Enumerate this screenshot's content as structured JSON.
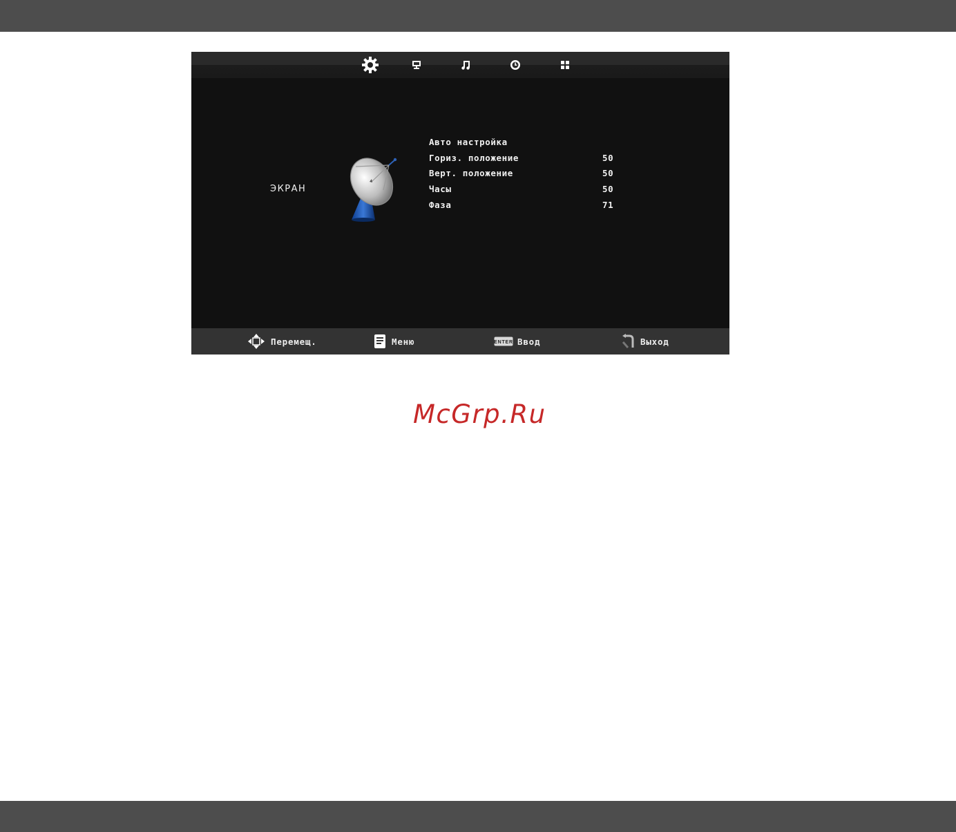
{
  "screen": {
    "section_title": "ЭКРАН",
    "tabs": [
      {
        "icon": "gear-icon",
        "selected": true
      },
      {
        "icon": "monitor-icon",
        "selected": false
      },
      {
        "icon": "music-note-icon",
        "selected": false
      },
      {
        "icon": "clock-icon",
        "selected": false
      },
      {
        "icon": "grid-icon",
        "selected": false
      }
    ],
    "section_icon": "satellite-dish-icon",
    "menu": [
      {
        "label": "Авто настройка",
        "value": ""
      },
      {
        "label": "Гориз. положение",
        "value": "50"
      },
      {
        "label": "Верт. положение",
        "value": "50"
      },
      {
        "label": "Часы",
        "value": "50"
      },
      {
        "label": "Фаза",
        "value": "71"
      }
    ],
    "help": {
      "move": {
        "icon": "arrows-icon",
        "label": "Перемещ."
      },
      "menu": {
        "icon": "menu-document-icon",
        "label": "Меню"
      },
      "enter": {
        "icon": "enter-key-icon",
        "key": "ENTER",
        "label": "Ввод"
      },
      "exit": {
        "icon": "exit-return-icon",
        "label": "Выход"
      }
    }
  },
  "watermark": "McGrp.Ru",
  "colors": {
    "page_bars": "#4d4d4d",
    "screen_bg": "#111111",
    "help_bar": "#333333",
    "watermark": "#c62828"
  }
}
